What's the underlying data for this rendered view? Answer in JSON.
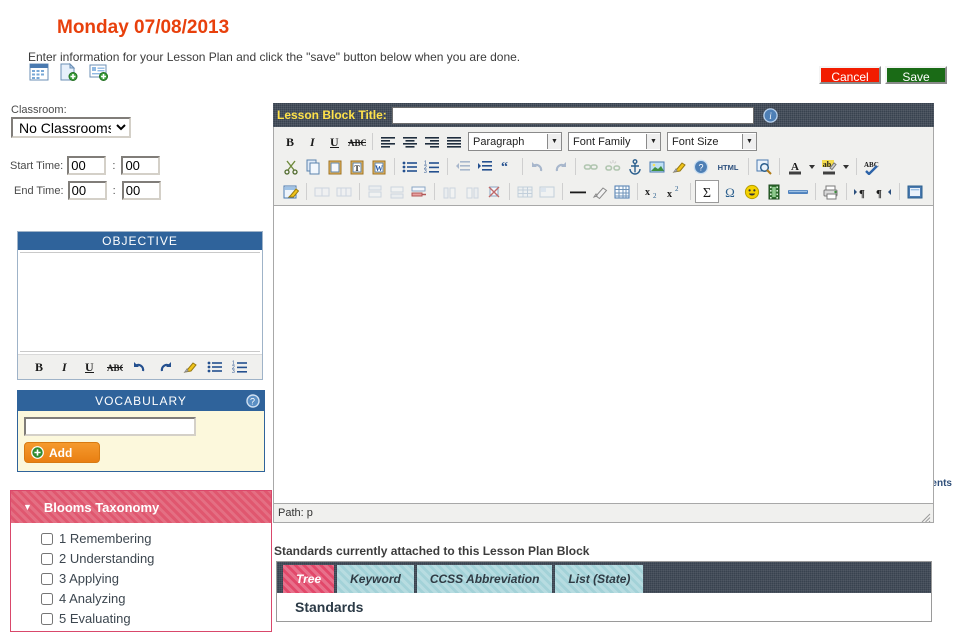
{
  "header": {
    "title": "Monday 07/08/2013",
    "instructions": "Enter information for your Lesson Plan and click the \"save\" button below when you are done.",
    "title_color": "#e8400c",
    "icons": [
      {
        "name": "calendar-icon",
        "glyph": "calendar"
      },
      {
        "name": "add-page-icon",
        "glyph": "page-add"
      },
      {
        "name": "add-block-icon",
        "glyph": "block-add"
      }
    ]
  },
  "actions": {
    "cancel_label": "Cancel",
    "save_label": "Save",
    "cancel_color": "#f21c00",
    "save_color": "#1a6b16"
  },
  "sidebar": {
    "classroom_label": "Classroom:",
    "classroom_value": "No Classrooms",
    "classroom_options": [
      "No Classrooms"
    ],
    "start_time_label": "Start Time:",
    "start_time_hour": "00",
    "start_time_minute": "00",
    "end_time_label": "End Time:",
    "end_time_hour": "00",
    "end_time_minute": "00",
    "time_separator": ":",
    "objective": {
      "header": "OBJECTIVE",
      "header_color": "#2f639b",
      "content": "",
      "toolbar": [
        {
          "name": "bold-icon",
          "label": "B"
        },
        {
          "name": "italic-icon",
          "label": "I"
        },
        {
          "name": "underline-icon",
          "label": "U"
        },
        {
          "name": "strikethrough-icon",
          "label": "ABC"
        },
        {
          "name": "undo-icon",
          "label": "↶"
        },
        {
          "name": "redo-icon",
          "label": "↷"
        },
        {
          "name": "remove-format-icon",
          "label": "✒"
        },
        {
          "name": "bullet-list-icon",
          "label": "☰"
        },
        {
          "name": "numbered-list-icon",
          "label": "☰"
        }
      ]
    },
    "vocabulary": {
      "header": "VOCABULARY",
      "header_color": "#2f639b",
      "background_color": "#fcf8dc",
      "input_value": "",
      "add_label": "Add",
      "help_icon": "help-circle-icon"
    },
    "uncheck_all_label": "Uncheck All Components",
    "blooms": {
      "title": "Blooms Taxonomy",
      "accent_color": "#e0576f",
      "collapsed": false,
      "items": [
        {
          "label": "1 Remembering",
          "checked": false
        },
        {
          "label": "2 Understanding",
          "checked": false
        },
        {
          "label": "3 Applying",
          "checked": false
        },
        {
          "label": "4 Analyzing",
          "checked": false
        },
        {
          "label": "5 Evaluating",
          "checked": false
        }
      ]
    }
  },
  "editor": {
    "title_label": "Lesson Block Title:",
    "title_value": "",
    "title_label_color": "#ffe24a",
    "titlebar_color": "#38424f",
    "info_icon": "info-circle-icon",
    "paragraph_select": "Paragraph",
    "font_family_select": "Font Family",
    "font_size_select": "Font Size",
    "content": "",
    "path_label": "Path: p",
    "toolbar_row1": [
      {
        "name": "bold-icon",
        "label": "B"
      },
      {
        "name": "italic-icon",
        "label": "I"
      },
      {
        "name": "underline-icon",
        "label": "U"
      },
      {
        "name": "strikethrough-icon",
        "label": "ABC"
      },
      {
        "name": "align-left-icon",
        "label": "≡"
      },
      {
        "name": "align-center-icon",
        "label": "≡"
      },
      {
        "name": "align-right-icon",
        "label": "≡"
      },
      {
        "name": "align-justify-icon",
        "label": "≡"
      }
    ],
    "toolbar_row2": [
      {
        "name": "cut-icon",
        "label": "✂"
      },
      {
        "name": "copy-icon",
        "label": "⧉"
      },
      {
        "name": "paste-icon",
        "label": "📋"
      },
      {
        "name": "paste-text-icon",
        "label": "T"
      },
      {
        "name": "paste-word-icon",
        "label": "W"
      },
      {
        "name": "bullet-list-icon",
        "label": "•≡"
      },
      {
        "name": "numbered-list-icon",
        "label": "1≡"
      },
      {
        "name": "outdent-icon",
        "label": "⇤"
      },
      {
        "name": "indent-icon",
        "label": "⇥"
      },
      {
        "name": "blockquote-icon",
        "label": "“"
      },
      {
        "name": "undo-icon",
        "label": "↶"
      },
      {
        "name": "redo-icon",
        "label": "↷"
      },
      {
        "name": "link-icon",
        "label": "⚭"
      },
      {
        "name": "unlink-icon",
        "label": "⚮"
      },
      {
        "name": "anchor-icon",
        "label": "⚓"
      },
      {
        "name": "image-icon",
        "label": "🌄"
      },
      {
        "name": "clean-icon",
        "label": "✒"
      },
      {
        "name": "help-icon",
        "label": "?"
      },
      {
        "name": "html-source-icon",
        "label": "HTML"
      },
      {
        "name": "preview-icon",
        "label": "🔍"
      },
      {
        "name": "text-color-icon",
        "label": "A"
      },
      {
        "name": "text-color-arrow-icon",
        "label": "▾"
      },
      {
        "name": "background-color-icon",
        "label": "ab"
      },
      {
        "name": "background-color-arrow-icon",
        "label": "▾"
      },
      {
        "name": "spellcheck-icon",
        "label": "ABC"
      }
    ],
    "toolbar_row3": [
      {
        "name": "edit-table-icon",
        "label": "✎"
      },
      {
        "name": "merge-cells-icon",
        "label": "▤"
      },
      {
        "name": "split-cells-icon",
        "label": "▥"
      },
      {
        "name": "insert-row-before-icon",
        "label": "↑"
      },
      {
        "name": "insert-row-after-icon",
        "label": "↓"
      },
      {
        "name": "delete-row-icon",
        "label": "→"
      },
      {
        "name": "insert-col-before-icon",
        "label": "←"
      },
      {
        "name": "insert-col-after-icon",
        "label": "→"
      },
      {
        "name": "delete-col-icon",
        "label": "✕"
      },
      {
        "name": "table-props-icon",
        "label": "▦"
      },
      {
        "name": "cell-props-icon",
        "label": "▧"
      },
      {
        "name": "horizontal-rule-icon",
        "label": "—"
      },
      {
        "name": "remove-format-icon",
        "label": "◇"
      },
      {
        "name": "insert-table-icon",
        "label": "▦"
      },
      {
        "name": "subscript-icon",
        "label": "x₂"
      },
      {
        "name": "superscript-icon",
        "label": "x²"
      },
      {
        "name": "sigma-icon",
        "label": "Σ"
      },
      {
        "name": "special-char-icon",
        "label": "Ω"
      },
      {
        "name": "emoticon-icon",
        "label": "☺"
      },
      {
        "name": "media-icon",
        "label": "🎞"
      },
      {
        "name": "page-break-icon",
        "label": "▃"
      },
      {
        "name": "print-icon",
        "label": "⎙"
      },
      {
        "name": "ltr-icon",
        "label": "¶"
      },
      {
        "name": "rtl-icon",
        "label": "¶"
      },
      {
        "name": "fullscreen-icon",
        "label": "▣"
      }
    ]
  },
  "standards": {
    "caption": "Standards currently attached to this Lesson Plan Block",
    "subtitle": "Standards",
    "active_tab": "Tree",
    "active_tab_color": "#e2486a",
    "tab_color": "#a3d2d8",
    "tabs": [
      {
        "label": "Tree",
        "active": true
      },
      {
        "label": "Keyword",
        "active": false
      },
      {
        "label": "CCSS Abbreviation",
        "active": false
      },
      {
        "label": "List (State)",
        "active": false
      }
    ]
  }
}
